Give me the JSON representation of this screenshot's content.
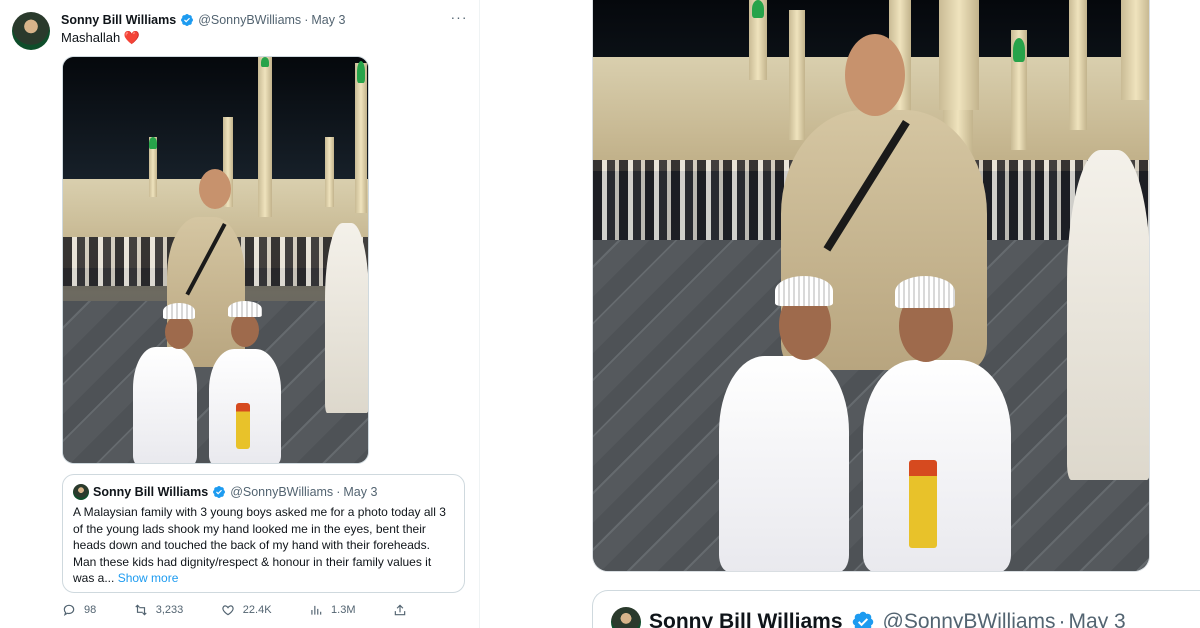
{
  "tweet": {
    "author_name": "Sonny Bill Williams",
    "handle": "@SonnyBWilliams",
    "separator": "·",
    "date": "May 3",
    "more_label": "···",
    "text": "Mashallah",
    "emoji": "❤️",
    "photo_alt": "Photo",
    "quote": {
      "author_name": "Sonny Bill Williams",
      "handle": "@SonnyBWilliams",
      "separator": "·",
      "date": "May 3",
      "text": "A Malaysian family with 3 young boys asked me for a photo today all 3 of the young lads shook my hand looked me in the eyes, bent their heads down and touched the back of my hand with their foreheads. Man these kids had dignity/respect & honour in their family values it was a...",
      "show_more": "Show more"
    },
    "actions": {
      "replies": "98",
      "reposts": "3,233",
      "likes": "22.4K",
      "views": "1.3M"
    }
  },
  "zoom": {
    "quote_author_name": "Sonny Bill Williams",
    "quote_handle": "@SonnyBWilliams",
    "quote_separator": "·",
    "quote_date": "May 3"
  },
  "icons": {
    "verified": "verified-badge-icon",
    "reply": "reply-icon",
    "repost": "repost-icon",
    "like": "heart-icon",
    "views": "views-chart-icon",
    "share": "share-icon"
  },
  "colors": {
    "accent": "#1d9bf0",
    "heart": "#e0245e",
    "secondary_text": "#536471"
  }
}
